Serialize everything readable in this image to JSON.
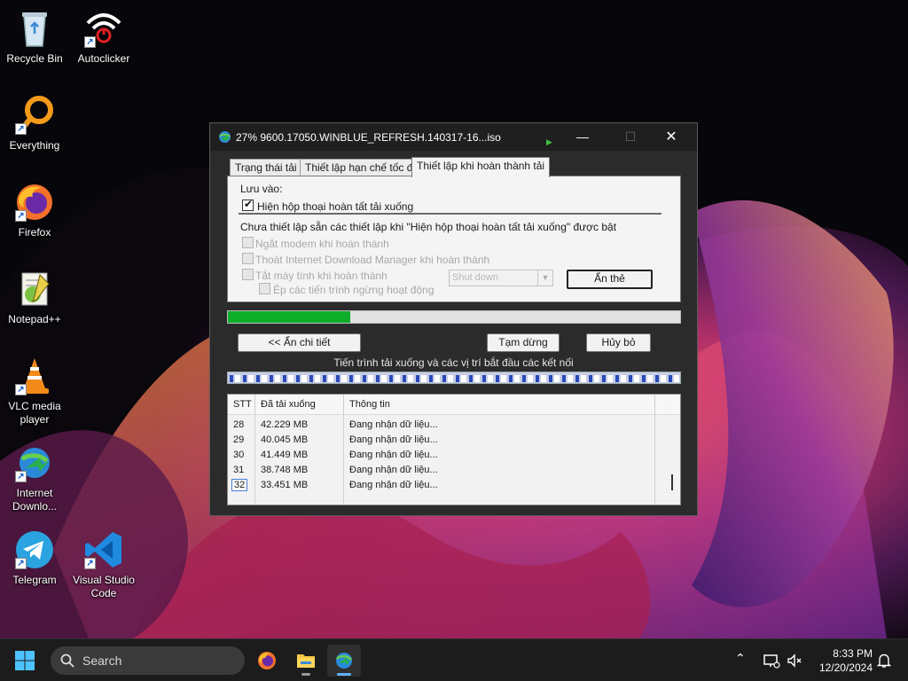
{
  "desktop": {
    "icons": [
      {
        "label": "Recycle Bin",
        "icon": "recycle-bin-icon",
        "shortcut": false
      },
      {
        "label": "Autoclicker",
        "icon": "autoclicker-icon",
        "shortcut": true
      },
      {
        "label": "Everything",
        "icon": "everything-search-icon",
        "shortcut": true
      },
      {
        "label": "Firefox",
        "icon": "firefox-icon",
        "shortcut": true
      },
      {
        "label": "Notepad++",
        "icon": "notepadpp-icon",
        "shortcut": false
      },
      {
        "label": "VLC media player",
        "icon": "vlc-icon",
        "shortcut": true
      },
      {
        "label": "Internet Downlo...",
        "icon": "idm-icon",
        "shortcut": true
      },
      {
        "label": "Telegram",
        "icon": "telegram-icon",
        "shortcut": true
      },
      {
        "label": "Visual Studio Code",
        "icon": "vscode-icon",
        "shortcut": true
      }
    ]
  },
  "window": {
    "title": "27% 9600.17050.WINBLUE_REFRESH.140317-16...iso",
    "controls": {
      "minimize": "—",
      "maximize": "☐",
      "close": "✕"
    },
    "tabs": [
      {
        "label": "Trạng thái tải",
        "active": false
      },
      {
        "label": "Thiết lập hạn chế tốc độ",
        "active": false
      },
      {
        "label": "Thiết lập khi hoàn thành tải",
        "active": true
      }
    ],
    "completion": {
      "save_label": "Lưu vào:",
      "show_dialog": {
        "label": "Hiện hộp thoại hoàn tất tải xuống",
        "checked": true
      },
      "note": "Chưa thiết lập sẵn các thiết lập khi  \"Hiện hộp thoại hoàn tất tải xuống\" được bật",
      "options": [
        {
          "label": "Ngắt modem khi hoàn thành",
          "checked": false,
          "enabled": false
        },
        {
          "label": "Thoát Internet Download Manager khi hoàn thành",
          "checked": false,
          "enabled": false
        },
        {
          "label": "Tắt máy tính khi hoàn thành",
          "checked": false,
          "enabled": false
        },
        {
          "label": "Ép các tiến trình ngừng hoạt động",
          "checked": false,
          "enabled": false
        }
      ],
      "shutdown_select": {
        "value": "Shut down",
        "enabled": false
      },
      "hide_tab_button": "Ẩn thẻ"
    },
    "progress": {
      "value": 0.27,
      "color": "#0fae2a"
    },
    "buttons": {
      "less": "<< Ẩn chi tiết",
      "pause": "Tạm dừng",
      "cancel": "Hủy bỏ"
    },
    "connections_caption": "Tiến trình tải xuống và các vị trí bắt đầu các kết nối",
    "connections": {
      "columns": [
        "STT",
        "Đã tải xuống",
        "Thông tin"
      ],
      "rows": [
        {
          "id": "28",
          "downloaded": "42.229  MB",
          "info": "Đang nhận dữ liệu..."
        },
        {
          "id": "29",
          "downloaded": "40.045  MB",
          "info": "Đang nhận dữ liệu..."
        },
        {
          "id": "30",
          "downloaded": "41.449  MB",
          "info": "Đang nhận dữ liệu..."
        },
        {
          "id": "31",
          "downloaded": "38.748  MB",
          "info": "Đang nhận dữ liệu..."
        },
        {
          "id": "32",
          "downloaded": "33.451  MB",
          "info": "Đang nhận dữ liệu...",
          "selected": true
        }
      ]
    }
  },
  "taskbar": {
    "search_placeholder": "Search",
    "apps": [
      {
        "name": "firefox-taskbar-icon",
        "active": false
      },
      {
        "name": "file-explorer-taskbar-icon",
        "active": false
      },
      {
        "name": "idm-taskbar-icon",
        "active": true
      }
    ],
    "clock": {
      "time": "8:33 PM",
      "date": "12/20/2024"
    }
  },
  "colors": {
    "accent": "#60b0ff",
    "progress": "#0fae2a",
    "titlebar": "#1f1f1f"
  }
}
